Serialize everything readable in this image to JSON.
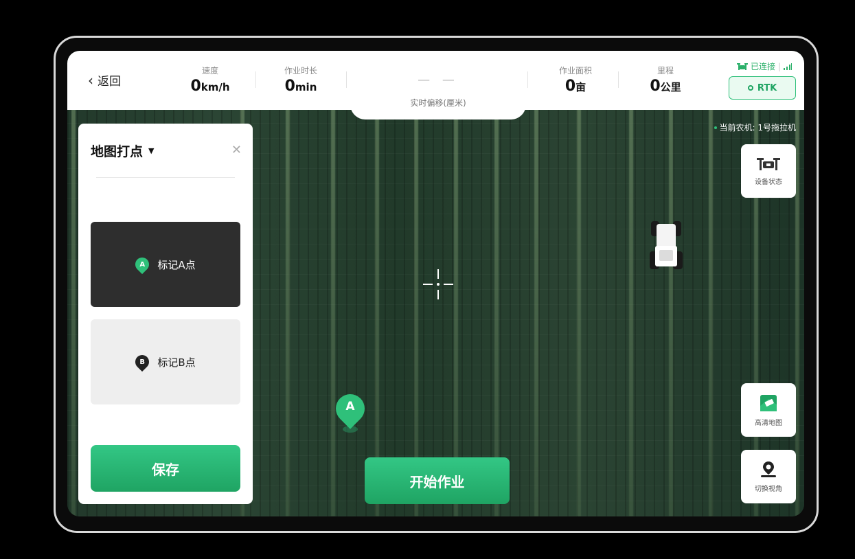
{
  "topbar": {
    "back_label": "返回",
    "speed": {
      "label": "速度",
      "value": "0",
      "unit": "km/h"
    },
    "duration": {
      "label": "作业时长",
      "value": "0",
      "unit": "min"
    },
    "offset": {
      "value": "— —",
      "label": "实时偏移(厘米)"
    },
    "area": {
      "label": "作业面积",
      "value": "0",
      "unit": "亩"
    },
    "distance": {
      "label": "里程",
      "value": "0",
      "unit": "公里"
    },
    "connection": {
      "status": "已连接",
      "separator": "|"
    },
    "rtk_label": "RTK"
  },
  "current_machine": "当前农机: 1号拖拉机",
  "panel": {
    "title": "地图打点",
    "mark_a": {
      "badge": "A",
      "label": "标记A点"
    },
    "mark_b": {
      "badge": "B",
      "label": "标记B点"
    },
    "save_label": "保存"
  },
  "map": {
    "pin_label": "A"
  },
  "tools": {
    "device_status": "设备状态",
    "hd_map": "高清地图",
    "switch_view": "切换视角"
  },
  "start_label": "开始作业",
  "colors": {
    "accent": "#2fc07a",
    "accent_dark": "#1fa463",
    "field": "#22392b"
  }
}
